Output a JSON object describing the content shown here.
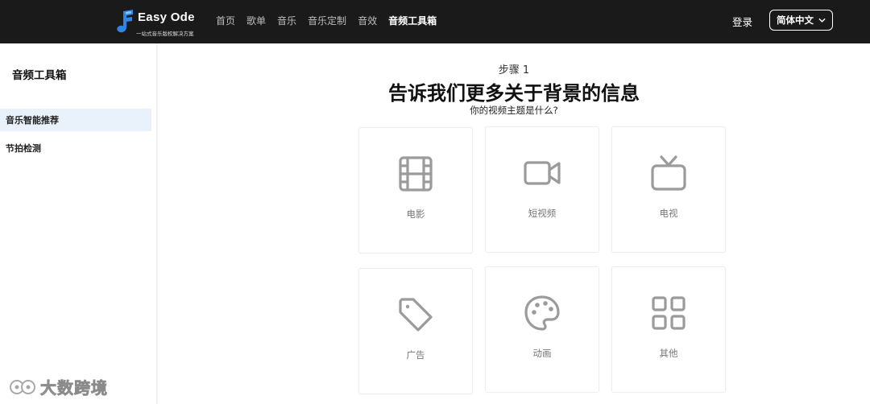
{
  "header": {
    "logo_text": "Easy Ode",
    "logo_tagline": "一站式音乐版权解决方案",
    "nav": [
      {
        "label": "首页"
      },
      {
        "label": "歌单"
      },
      {
        "label": "音乐"
      },
      {
        "label": "音乐定制"
      },
      {
        "label": "音效"
      },
      {
        "label": "音频工具箱",
        "active": true
      }
    ],
    "login_label": "登录",
    "language_label": "简体中文",
    "background_color": "#1a1a1a"
  },
  "sidebar": {
    "title": "音频工具箱",
    "items": [
      {
        "label": "音乐智能推荐",
        "active": true
      },
      {
        "label": "节拍检测"
      }
    ],
    "active_color": "#e9f2fb"
  },
  "main": {
    "step_label": "步骤 1",
    "headline": "告诉我们更多关于背景的信息",
    "question": "你的视频主题是什么?",
    "options": [
      {
        "label": "电影",
        "icon": "film-icon"
      },
      {
        "label": "短视频",
        "icon": "video-camera-icon"
      },
      {
        "label": "电视",
        "icon": "tv-icon"
      },
      {
        "label": "广告",
        "icon": "tag-icon"
      },
      {
        "label": "动画",
        "icon": "palette-icon"
      },
      {
        "label": "其他",
        "icon": "grid-icon"
      }
    ],
    "icon_color": "#9b9b9b"
  },
  "watermark": {
    "text": "大数跨境"
  }
}
